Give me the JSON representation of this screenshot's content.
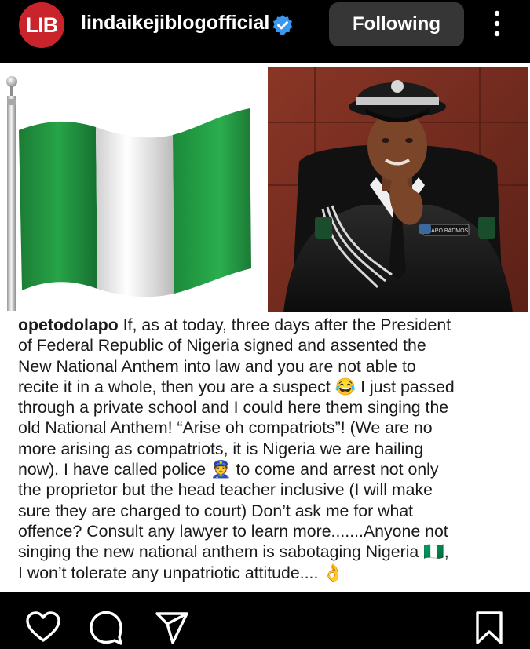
{
  "header": {
    "logo_text": "LIB",
    "username": "lindaikejiblogofficial",
    "verified_icon": "verified-badge-icon",
    "follow_label": "Following",
    "more_icon": "more-vertical-icon"
  },
  "post": {
    "left_image": "nigerian-flag",
    "right_image": "police-officer-portrait",
    "name_tag": "OLAPO BADMOS",
    "caption": {
      "author": "opetodolapo",
      "lines": [
        " If, as at today, three days after the President",
        "of Federal Republic of Nigeria signed and assented the",
        "New National Anthem into law and you are not able to",
        "recite it in a whole, then you are a suspect 😂 I just passed",
        "through a private school and I could here them singing the",
        "old National Anthem! “Arise oh compatriots”! (We are no",
        "more arising as compatriots, it is Nigeria we are hailing",
        "now). I have called police 👮 to come and arrest not only",
        "the proprietor but the head teacher inclusive (I will make",
        "sure they are charged to court) Don’t ask me for what",
        "offence? Consult any lawyer to learn more.......Anyone not",
        "singing the new national anthem is sabotaging Nigeria 🇳🇬,",
        "I won’t tolerate any unpatriotic attitude.... 👌"
      ]
    }
  },
  "action_bar": {
    "icons": [
      "heart-icon",
      "comment-icon",
      "share-icon",
      "bookmark-icon"
    ]
  },
  "colors": {
    "background": "#000000",
    "follow_button": "#363636",
    "logo_red": "#c9242b",
    "verified_blue": "#3897f0",
    "flag_green": "#1e8a3a"
  }
}
